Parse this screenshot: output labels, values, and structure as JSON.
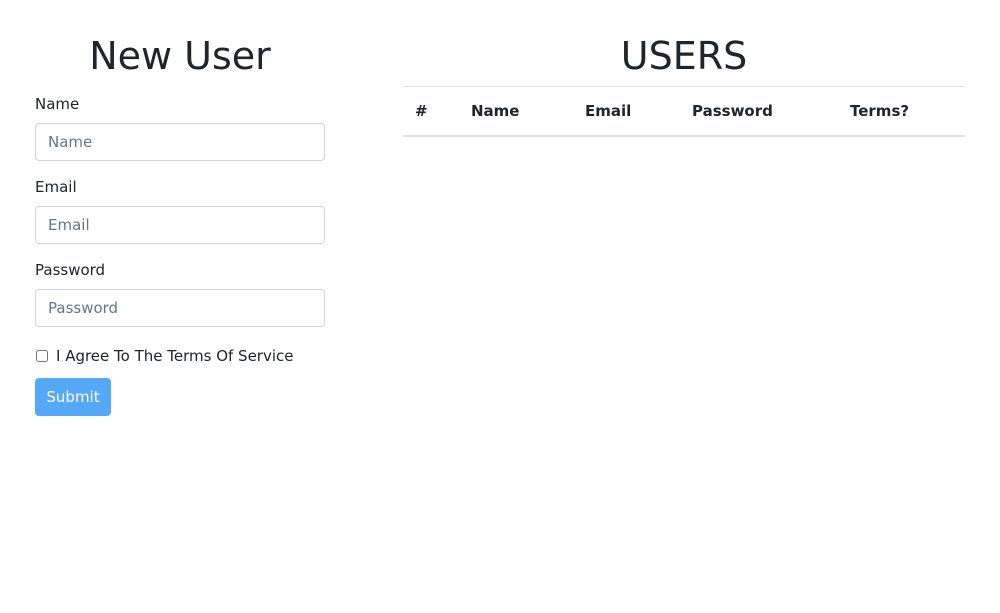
{
  "form": {
    "title": "New User",
    "name_label": "Name",
    "name_placeholder": "Name",
    "email_label": "Email",
    "email_placeholder": "Email",
    "password_label": "Password",
    "password_placeholder": "Password",
    "terms_label": "I Agree To The Terms Of Service",
    "submit_label": "Submit"
  },
  "users": {
    "title": "USERS",
    "columns": [
      "#",
      "Name",
      "Email",
      "Password",
      "Terms?"
    ]
  },
  "colors": {
    "submit_bg": "#55a9f8",
    "text": "#212529",
    "border": "#dee2e6"
  }
}
